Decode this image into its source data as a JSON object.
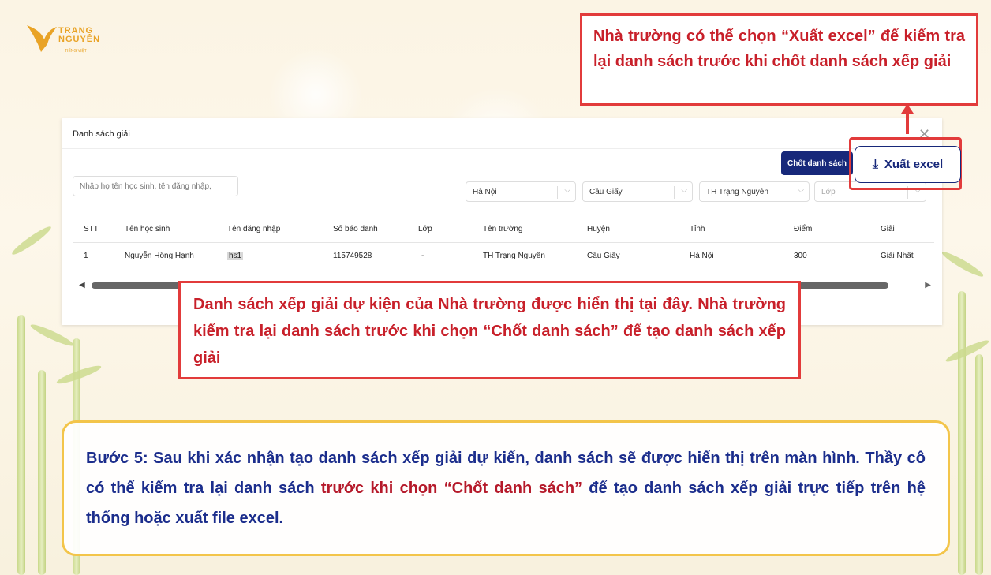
{
  "logo": {
    "line1": "TRANG",
    "line2": "NGUYÊN",
    "sub": "TIẾNG VIỆT"
  },
  "modal": {
    "title": "Danh sách giải",
    "close_icon": "close-icon",
    "search_placeholder": "Nhập họ tên học sinh, tên đăng nhập, ",
    "filters": [
      {
        "value": "Hà Nội"
      },
      {
        "value": "Cầu Giấy"
      },
      {
        "value": "TH Trạng Nguyên"
      },
      {
        "value": "Lớp"
      }
    ],
    "chot_button": "Chốt danh sách",
    "table": {
      "headers": [
        "STT",
        "Tên học sinh",
        "Tên đăng nhập",
        "Số báo danh",
        "Lớp",
        "Tên trường",
        "Huyện",
        "Tỉnh",
        "Điểm",
        "Giải"
      ],
      "rows": [
        [
          "1",
          "Nguyễn Hồng Hạnh",
          "hs1",
          "115749528",
          "-",
          "TH Trạng Nguyên",
          "Cầu Giấy",
          "Hà Nội",
          "300",
          "Giải Nhất"
        ]
      ]
    }
  },
  "excel_button": {
    "label": "Xuất excel",
    "icon": "download-icon"
  },
  "callouts": {
    "top": "Nhà trường có thể chọn “Xuất excel” để kiểm tra lại danh sách trước khi chốt danh sách xếp giải",
    "middle": "Danh sách xếp giải dự kiện của Nhà trường được hiển thị tại đây. Nhà trường kiểm tra lại danh sách trước khi chọn “Chốt danh sách” để tạo danh sách xếp giải"
  },
  "step": {
    "part1": " Bước 5: Sau khi xác nhận tạo danh sách xếp giải dự kiến, danh sách sẽ được hiển thị trên màn hình. Thầy cô có thể kiểm tra lại danh sách ",
    "part2": "trước khi chọn “Chốt danh sách”",
    "part3": " để tạo danh sách xếp giải trực tiếp trên hệ thống hoặc xuất file excel."
  },
  "colors": {
    "accent_red": "#e23b3b",
    "navy": "#17287a",
    "step_text": "#1b2d8c",
    "step_border": "#f3c54a"
  }
}
